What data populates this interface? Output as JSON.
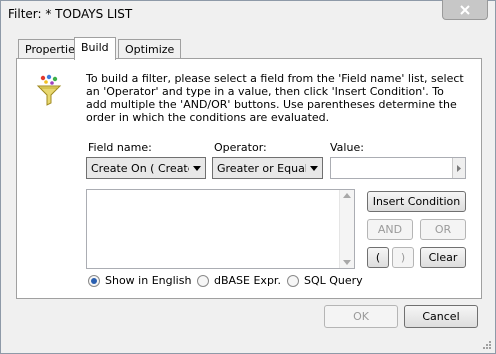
{
  "window": {
    "title": "Filter: * TODAYS LIST"
  },
  "tabs": [
    {
      "label": "Properties"
    },
    {
      "label": "Build"
    },
    {
      "label": "Optimize"
    }
  ],
  "build": {
    "description": "To build a filter, please select a field from the 'Field name' list, select an 'Operator'  and type in a value, then click 'Insert Condition'. To add multiple the 'AND/OR' buttons.  Use parentheses determine the order in which the conditions are evaluated.",
    "field_name_label": "Field name:",
    "operator_label": "Operator:",
    "value_label": "Value:",
    "field_name_value": "Create On ( Createo",
    "operator_value": "Greater or Equal",
    "value": "",
    "condition_text": "",
    "insert_condition": "Insert Condition",
    "and": "AND",
    "or": "OR",
    "open_paren": "(",
    "close_paren": ")",
    "clear": "Clear",
    "radio_options": [
      {
        "label": "Show in English",
        "checked": true
      },
      {
        "label": "dBASE Expr.",
        "checked": false
      },
      {
        "label": "SQL Query",
        "checked": false
      }
    ]
  },
  "footer": {
    "ok": "OK",
    "cancel": "Cancel"
  }
}
